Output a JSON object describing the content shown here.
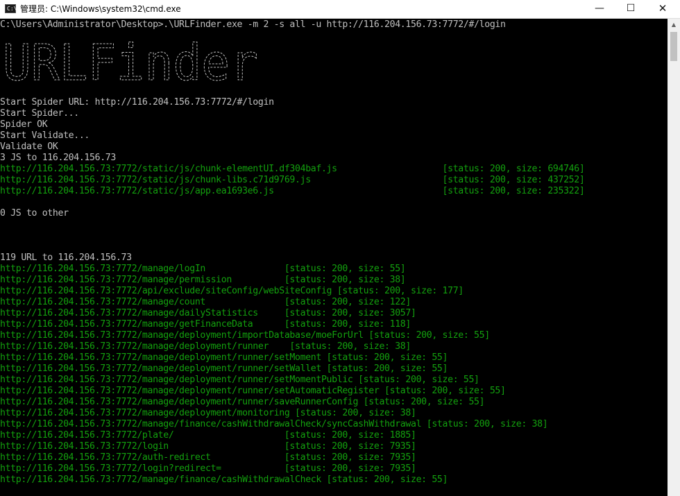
{
  "window": {
    "title": "管理员: C:\\Windows\\system32\\cmd.exe",
    "app_icon_text": "C:\\",
    "minimize_glyph": "—",
    "maximize_glyph": "☐",
    "close_glyph": "✕"
  },
  "console": {
    "command": "C:\\Users\\Administrator\\Desktop>.\\URLFinder.exe -m 2 -s all -u http://116.204.156.73:7772/#/login",
    "banner_text": "URLFinder",
    "status_lines": [
      "Start Spider URL: http://116.204.156.73:7772/#/login",
      "Start Spider...",
      "Spider OK",
      "Start Validate...",
      "Validate OK",
      "3 JS to 116.204.156.73"
    ],
    "js_results": [
      "http://116.204.156.73:7772/static/js/chunk-elementUI.df304baf.js                    [status: 200, size: 694746]",
      "http://116.204.156.73:7772/static/js/chunk-libs.c71d9769.js                         [status: 200, size: 437252]",
      "http://116.204.156.73:7772/static/js/app.ea1693e6.js                                [status: 200, size: 235322]"
    ],
    "js_other": "0 JS to other",
    "url_header": "119 URL to 116.204.156.73",
    "url_results": [
      "http://116.204.156.73:7772/manage/logIn               [status: 200, size: 55]",
      "http://116.204.156.73:7772/manage/permission          [status: 200, size: 38]",
      "http://116.204.156.73:7772/api/exclude/siteConfig/webSiteConfig [status: 200, size: 177]",
      "http://116.204.156.73:7772/manage/count               [status: 200, size: 122]",
      "http://116.204.156.73:7772/manage/dailyStatistics     [status: 200, size: 3057]",
      "http://116.204.156.73:7772/manage/getFinanceData      [status: 200, size: 118]",
      "http://116.204.156.73:7772/manage/deployment/importDatabase/moeForUrl [status: 200, size: 55]",
      "http://116.204.156.73:7772/manage/deployment/runner    [status: 200, size: 38]",
      "http://116.204.156.73:7772/manage/deployment/runner/setMoment [status: 200, size: 55]",
      "http://116.204.156.73:7772/manage/deployment/runner/setWallet [status: 200, size: 55]",
      "http://116.204.156.73:7772/manage/deployment/runner/setMomentPublic [status: 200, size: 55]",
      "http://116.204.156.73:7772/manage/deployment/runner/setAutomaticRegister [status: 200, size: 55]",
      "http://116.204.156.73:7772/manage/deployment/runner/saveRunnerConfig [status: 200, size: 55]",
      "http://116.204.156.73:7772/manage/deployment/monitoring [status: 200, size: 38]",
      "http://116.204.156.73:7772/manage/finance/cashWithdrawalCheck/syncCashWithdrawal [status: 200, size: 38]",
      "http://116.204.156.73:7772/plate/                     [status: 200, size: 1885]",
      "http://116.204.156.73:7772/login                      [status: 200, size: 7935]",
      "http://116.204.156.73:7772/auth-redirect              [status: 200, size: 7935]",
      "http://116.204.156.73:7772/login?redirect=            [status: 200, size: 7935]",
      "http://116.204.156.73:7772/manage/finance/cashWithdrawalCheck [status: 200, size: 55]"
    ]
  },
  "colors": {
    "background": "#000000",
    "text": "#c0c0c0",
    "found_url": "#13a10e"
  }
}
